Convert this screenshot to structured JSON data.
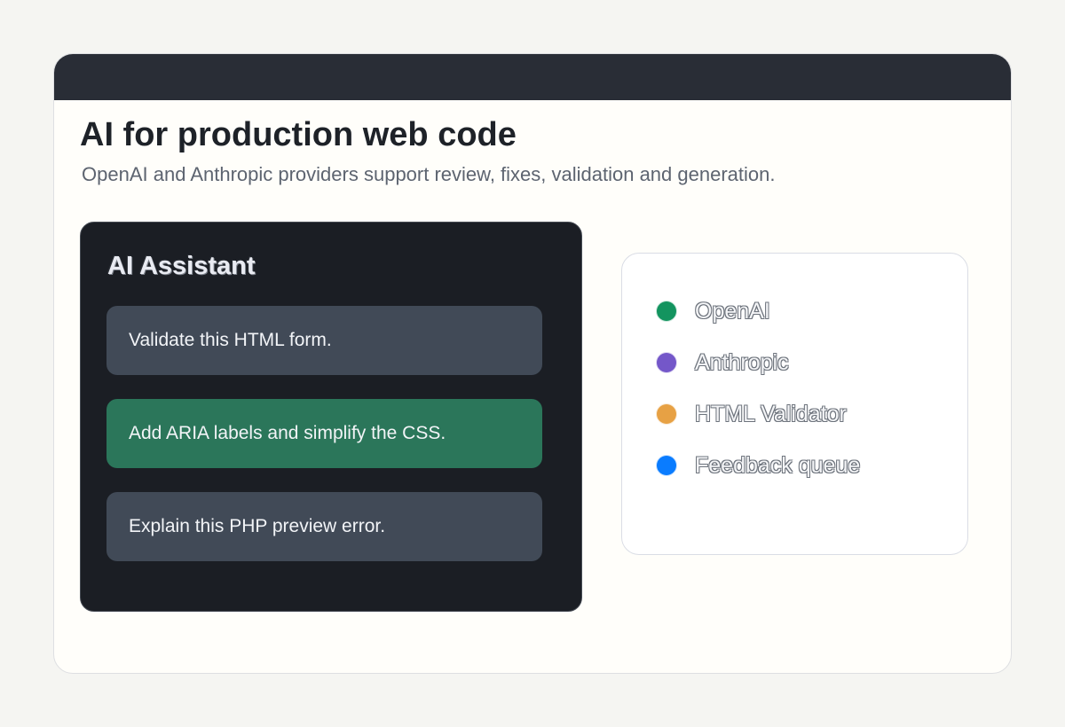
{
  "page": {
    "title": "AI for production web code",
    "subtitle": "OpenAI and Anthropic providers support review, fixes, validation and generation."
  },
  "assistant": {
    "title": "AI Assistant",
    "prompts": [
      {
        "label": "Validate this HTML form.",
        "selected": false
      },
      {
        "label": "Add ARIA labels and simplify the CSS.",
        "selected": true
      },
      {
        "label": "Explain this PHP preview error.",
        "selected": false
      }
    ],
    "colors": {
      "panel": "#1b1e24",
      "prompt": "#414a57",
      "selected_prompt": "#2b765a"
    }
  },
  "providers": [
    {
      "label": "OpenAI",
      "color": "#13945f"
    },
    {
      "label": "Anthropic",
      "color": "#7457c9"
    },
    {
      "label": "HTML Validator",
      "color": "#e7a144"
    },
    {
      "label": "Feedback queue",
      "color": "#0a7cff"
    }
  ]
}
